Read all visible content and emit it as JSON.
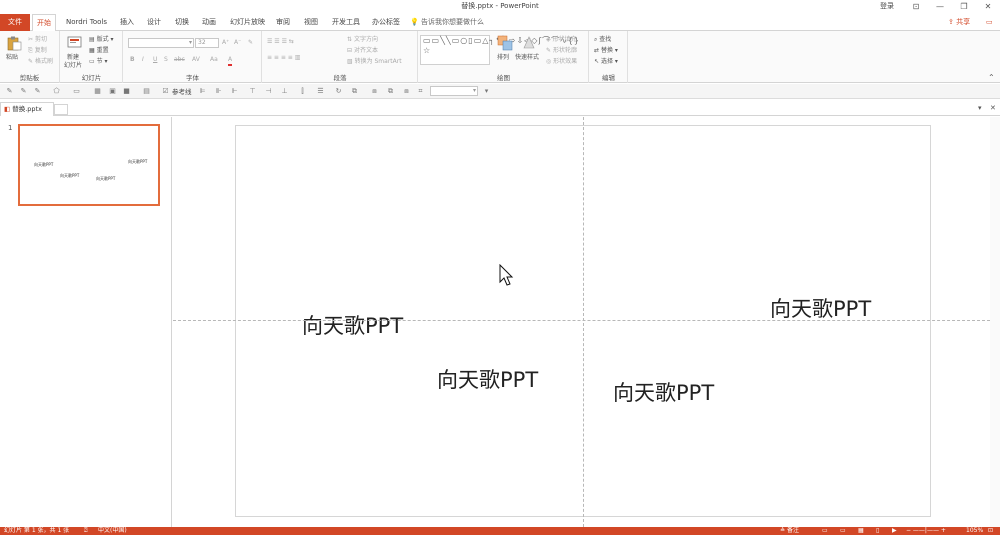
{
  "window": {
    "doc_title": "替换.pptx  -  PowerPoint",
    "login": "登录",
    "controls": [
      "⊡",
      "—",
      "❐",
      "✕"
    ]
  },
  "tabs": {
    "file": "文件",
    "items": [
      "开始",
      "Nordri Tools",
      "插入",
      "设计",
      "切换",
      "动画",
      "幻灯片放映",
      "审阅",
      "视图",
      "开发工具",
      "办公标签"
    ],
    "active_index": 0,
    "tell_me": "告诉我你想要做什么",
    "share": "共享"
  },
  "ribbon": {
    "clipboard": {
      "label": "剪贴板",
      "paste": "粘贴",
      "cut": "剪切",
      "copy": "复制",
      "format_painter": "格式刷"
    },
    "slides": {
      "label": "幻灯片",
      "new_slide": "新建",
      "new_slide_sub": "幻灯片",
      "layout": "版式",
      "reset": "重置",
      "section": "节"
    },
    "font": {
      "label": "字体",
      "font_size": "32",
      "buttons": [
        "B",
        "I",
        "U",
        "S",
        "abc",
        "AV",
        "Aa",
        "A"
      ]
    },
    "paragraph": {
      "label": "段落",
      "text_direction": "文字方向",
      "align_text": "对齐文本",
      "convert_smartart": "转换为 SmartArt"
    },
    "drawing": {
      "label": "绘图",
      "arrange": "排列",
      "quick_styles": "快速样式",
      "shape_fill": "形状填充",
      "shape_outline": "形状轮廓",
      "shape_effects": "形状效果",
      "shapes_gallery": "▭▭╲╲▭○▯▭△┐↰╲⇨⇩◁◇ʃ⌒⌒∿{}☆"
    },
    "editing": {
      "label": "编辑",
      "find": "查找",
      "replace": "替换",
      "select": "选择"
    }
  },
  "qat": {
    "reference_line": "参考线"
  },
  "doc_tab": {
    "name": "替换.pptx"
  },
  "thumbnails": {
    "slide_number": "1",
    "texts": [
      "向天歌PPT",
      "向天歌PPT",
      "向天歌PPT",
      "向天歌PPT"
    ]
  },
  "slide": {
    "texts": [
      "向天歌PPT",
      "向天歌PPT",
      "向天歌PPT",
      "向天歌PPT"
    ]
  },
  "statusbar": {
    "slide_info": "幻灯片 第 1 张，共 1 张",
    "language": "中文(中国)",
    "notes": "备注",
    "zoom": "105%"
  },
  "colors": {
    "accent": "#d24726",
    "thumb_border": "#e36c3c"
  }
}
